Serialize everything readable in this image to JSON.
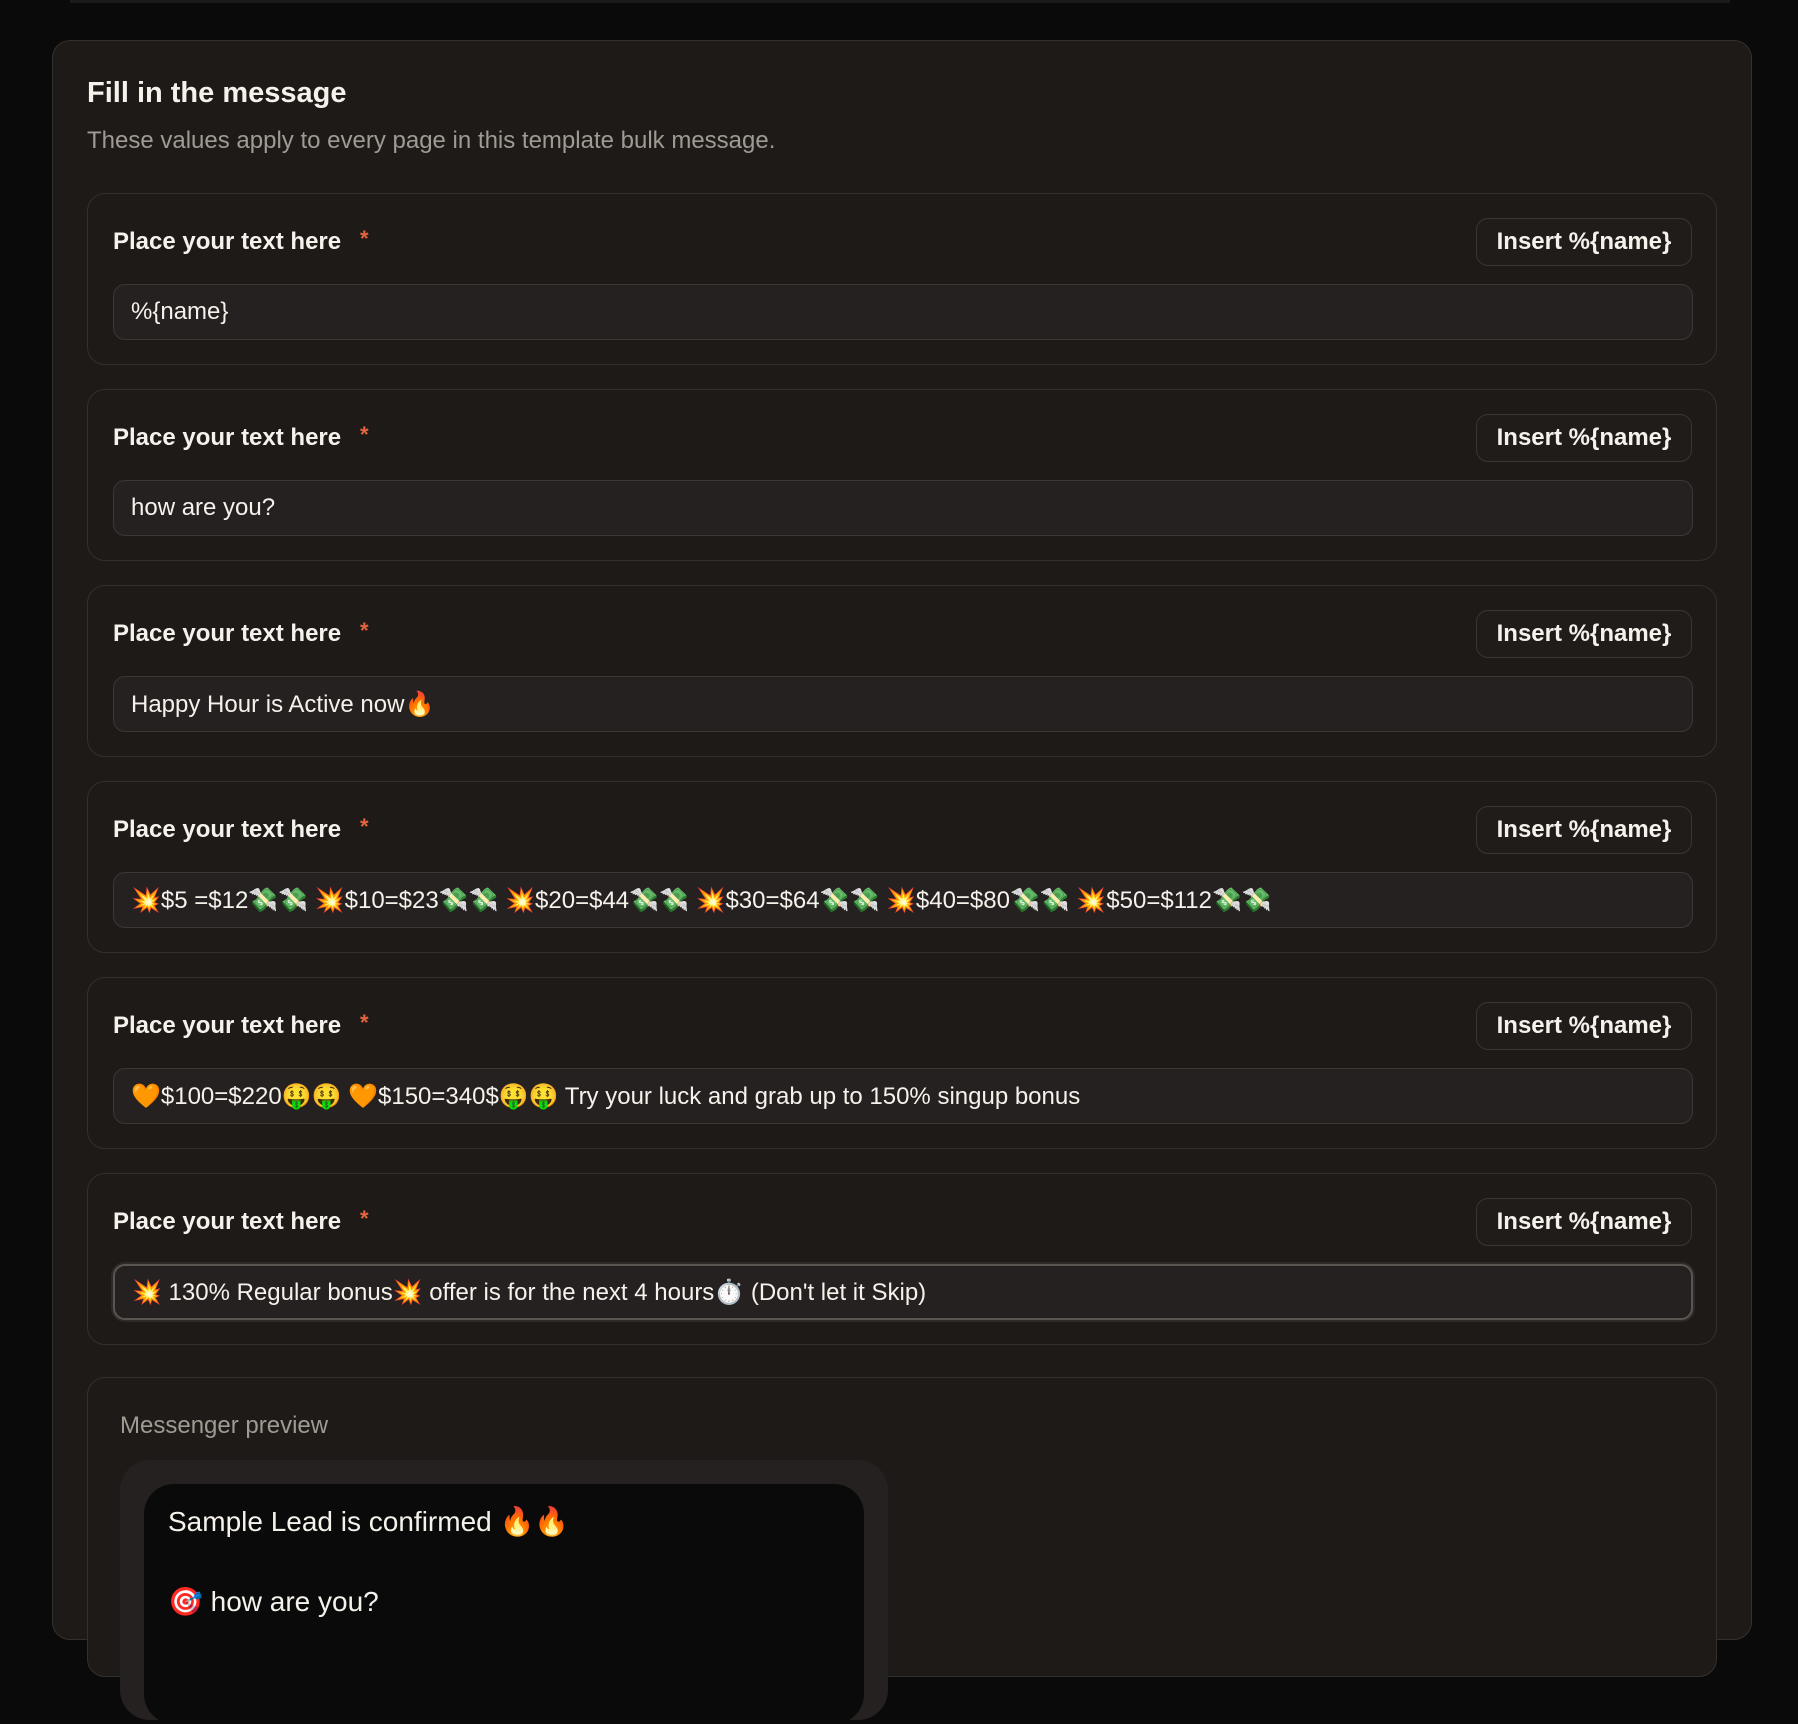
{
  "card": {
    "title": "Fill in the message",
    "subtitle": "These values apply to every page in this template bulk message."
  },
  "fields": [
    {
      "label": "Place your text here",
      "required_mark": "*",
      "insert_label": "Insert %{name}",
      "value": "%{name}"
    },
    {
      "label": "Place your text here",
      "required_mark": "*",
      "insert_label": "Insert %{name}",
      "value": "how are you?"
    },
    {
      "label": "Place your text here",
      "required_mark": "*",
      "insert_label": "Insert %{name}",
      "value": "Happy Hour is Active now🔥"
    },
    {
      "label": "Place your text here",
      "required_mark": "*",
      "insert_label": "Insert %{name}",
      "value": "💥$5 =$12💸💸 💥$10=$23💸💸 💥$20=$44💸💸 💥$30=$64💸💸 💥$40=$80💸💸 💥$50=$112💸💸"
    },
    {
      "label": "Place your text here",
      "required_mark": "*",
      "insert_label": "Insert %{name}",
      "value": "🧡$100=$220🤑🤑 🧡$150=340$🤑🤑 Try your luck and grab up to 150% singup bonus"
    },
    {
      "label": "Place your text here",
      "required_mark": "*",
      "insert_label": "Insert %{name}",
      "value": "💥 130% Regular bonus💥 offer is for the next 4 hours⏱️ (Don't let it Skip)"
    }
  ],
  "preview": {
    "label": "Messenger preview",
    "lines": [
      "Sample Lead is confirmed 🔥🔥",
      "",
      "🎯 how are you?"
    ]
  },
  "colors": {
    "background": "#0b0a0a",
    "card": "#1d1a18",
    "required_accent": "#e8643c",
    "muted_text": "#a09a93"
  }
}
